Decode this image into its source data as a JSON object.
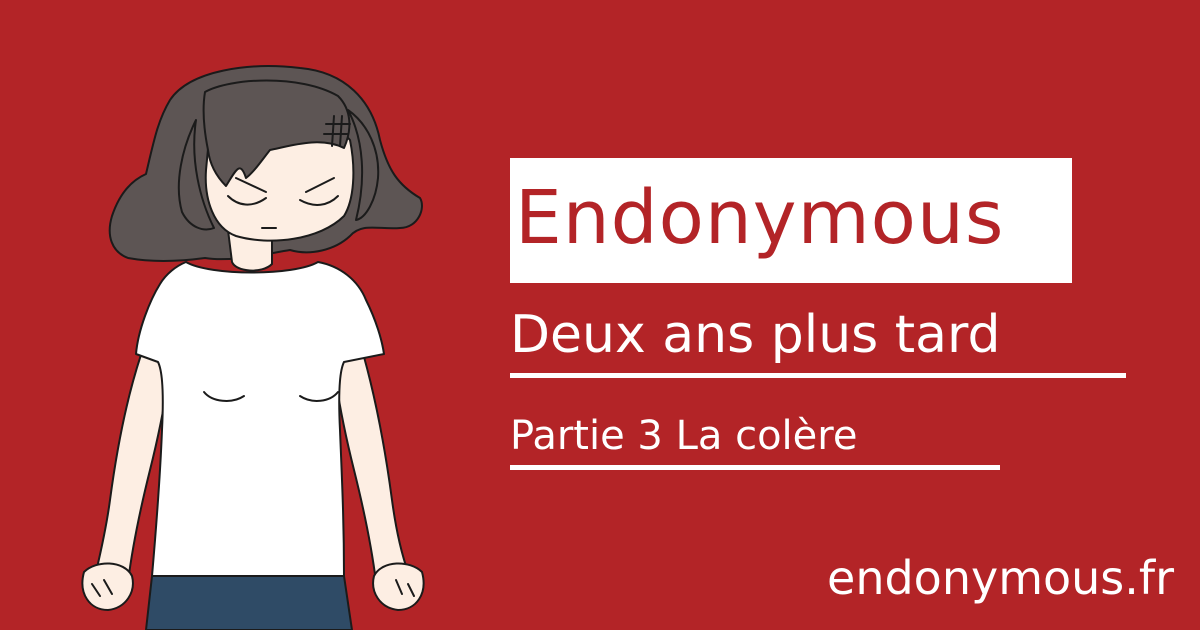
{
  "colors": {
    "background": "#b32427",
    "title_box": "#ffffff",
    "title_text": "#b32427",
    "text": "#ffffff",
    "hair": "#5d5554",
    "skin": "#fdeee3",
    "shirt": "#ffffff",
    "pants": "#2f4b66",
    "outline": "#1b1b1b"
  },
  "illustration": {
    "icon": "angry-woman-illustration",
    "anger_mark_icon": "anger-symbol-icon"
  },
  "title": "Endonymous",
  "subtitle": "Deux ans plus tard",
  "part": "Partie 3 La colère",
  "site": "endonymous.fr"
}
